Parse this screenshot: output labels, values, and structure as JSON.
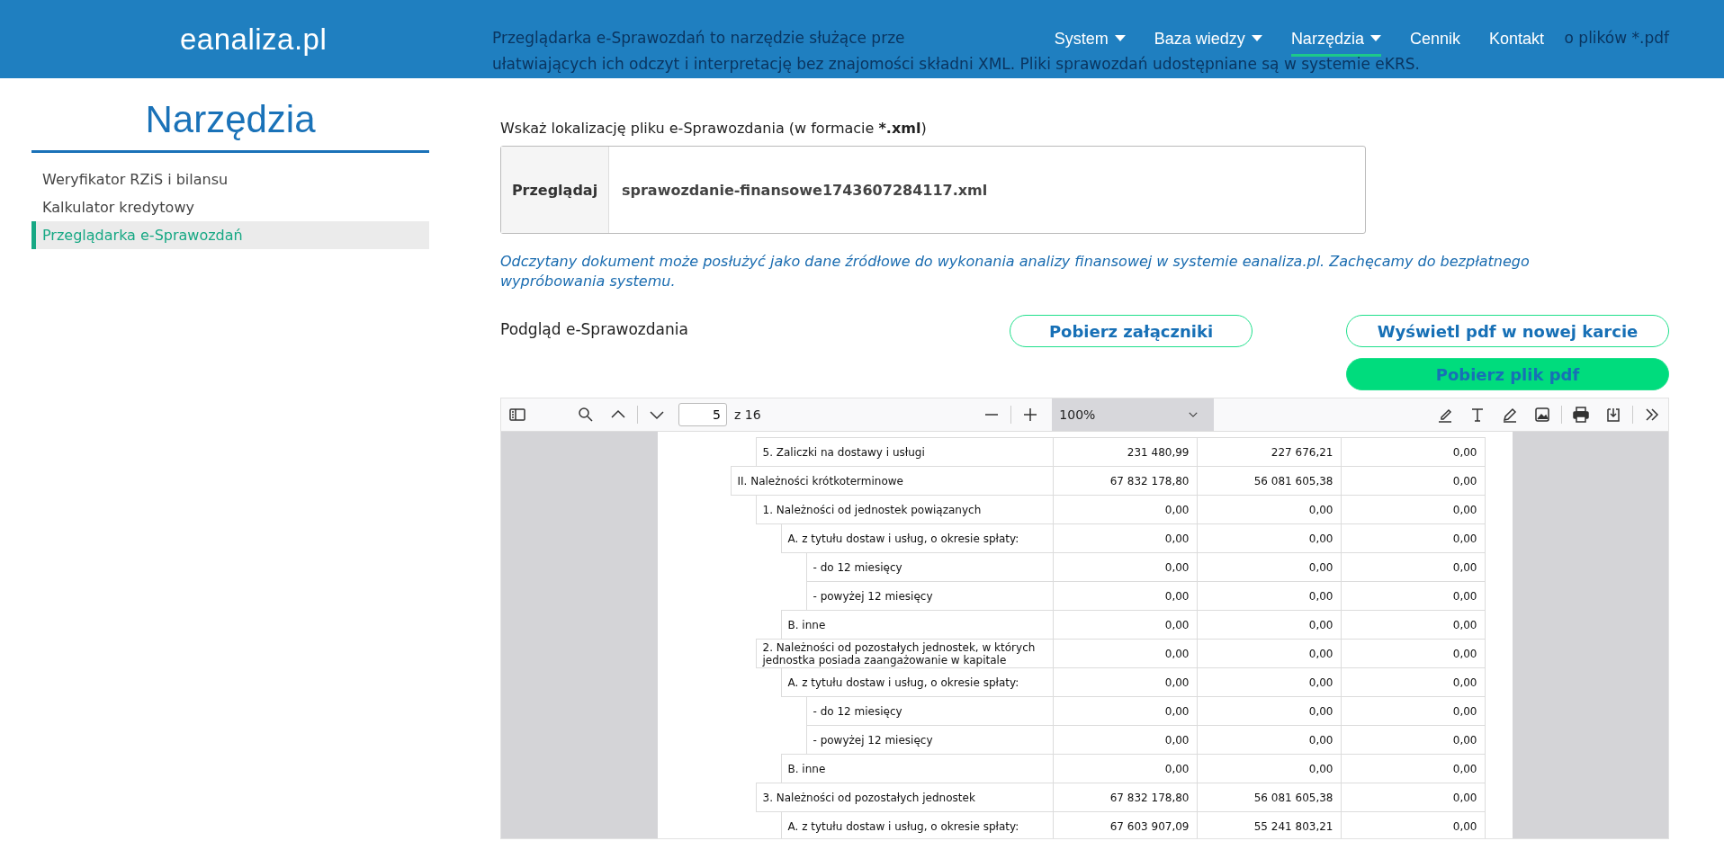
{
  "header": {
    "logo": "eanaliza.pl",
    "nav": [
      {
        "label": "System",
        "dropdown": true,
        "selected": false
      },
      {
        "label": "Baza wiedzy",
        "dropdown": true,
        "selected": false
      },
      {
        "label": "Narzędzia",
        "dropdown": true,
        "selected": true
      },
      {
        "label": "Cennik",
        "dropdown": false,
        "selected": false
      },
      {
        "label": "Kontakt",
        "dropdown": false,
        "selected": false
      }
    ]
  },
  "intro": {
    "line_1_start": "Przeglądarka e-Sprawozdań to narzędzie służące prze",
    "line_1_end": "o plików *.pdf",
    "line_2": "ułatwiających ich odczyt i interpretację bez znajomości składni XML. Pliki sprawozdań udostępniane są w systemie",
    "link": "eKRS",
    "line_2_end": "."
  },
  "sidebar": {
    "title": "Narzędzia",
    "items": [
      {
        "label": "Weryfikator RZiS i bilansu",
        "selected": false
      },
      {
        "label": "Kalkulator kredytowy",
        "selected": false
      },
      {
        "label": "Przeglądarka e-Sprawozdań",
        "selected": true
      }
    ]
  },
  "file_picker": {
    "label": "Wskaż lokalizację pliku e-Sprawozdania (w formacie",
    "label_bold": "*.xml",
    "label_end": ")",
    "button": "Przeglądaj",
    "value": "sprawozdanie-finansowe1743607284117.xml"
  },
  "note": {
    "text": "Odczytany dokument może posłużyć jako dane źródłowe do wykonania analizy finansowej w systemie eanaliza.pl. Zachęcamy do bezpłatnego",
    "link": "wypróbowania systemu",
    "end": "."
  },
  "preview": {
    "title": "Podgląd e-Sprawozdania",
    "buttons": [
      {
        "label": "Pobierz załączniki",
        "kind": "outline"
      },
      {
        "label": "Wyświetl pdf w nowej karcie",
        "kind": "outline"
      },
      {
        "label": "Pobierz plik pdf",
        "kind": "filled"
      }
    ]
  },
  "viewer": {
    "page": "5",
    "page_count": "z 16",
    "zoom": "100%",
    "rows": [
      {
        "children": [
          {
            "label": "5. Zaliczki na dostawy i usługi",
            "values": [
              "231 480,99",
              "227 676,21",
              "0,00"
            ]
          }
        ]
      },
      {
        "label": "II. Należności krótkoterminowe",
        "values": [
          "67 832 178,80",
          "56 081 605,38",
          "0,00"
        ],
        "children": [
          {
            "label": "1. Należności od jednostek powiązanych",
            "values": [
              "0,00",
              "0,00",
              "0,00"
            ],
            "children": [
              {
                "label": "A. z tytułu dostaw i usług, o okresie spłaty:",
                "values": [
                  "0,00",
                  "0,00",
                  "0,00"
                ],
                "children": [
                  {
                    "label": "- do 12 miesięcy",
                    "values": [
                      "0,00",
                      "0,00",
                      "0,00"
                    ]
                  },
                  {
                    "label": "- powyżej 12 miesięcy",
                    "values": [
                      "0,00",
                      "0,00",
                      "0,00"
                    ]
                  }
                ]
              },
              {
                "label": "B. inne",
                "values": [
                  "0,00",
                  "0,00",
                  "0,00"
                ]
              }
            ]
          },
          {
            "label": "2. Należności od pozostałych jednostek, w których jednostka posiada zaangażowanie w kapitale",
            "values": [
              "0,00",
              "0,00",
              "0,00"
            ],
            "children": [
              {
                "label": "A. z tytułu dostaw i usług, o okresie spłaty:",
                "values": [
                  "0,00",
                  "0,00",
                  "0,00"
                ],
                "children": [
                  {
                    "label": "- do 12 miesięcy",
                    "values": [
                      "0,00",
                      "0,00",
                      "0,00"
                    ]
                  },
                  {
                    "label": "- powyżej 12 miesięcy",
                    "values": [
                      "0,00",
                      "0,00",
                      "0,00"
                    ]
                  }
                ]
              },
              {
                "label": "B. inne",
                "values": [
                  "0,00",
                  "0,00",
                  "0,00"
                ]
              }
            ]
          },
          {
            "label": "3. Należności od pozostałych jednostek",
            "values": [
              "67 832 178,80",
              "56 081 605,38",
              "0,00"
            ],
            "children": [
              {
                "label": "A. z tytułu dostaw i usług, o okresie spłaty:",
                "values": [
                  "67 603 907,09",
                  "55 241 803,21",
                  "0,00"
                ]
              }
            ]
          }
        ]
      }
    ]
  }
}
